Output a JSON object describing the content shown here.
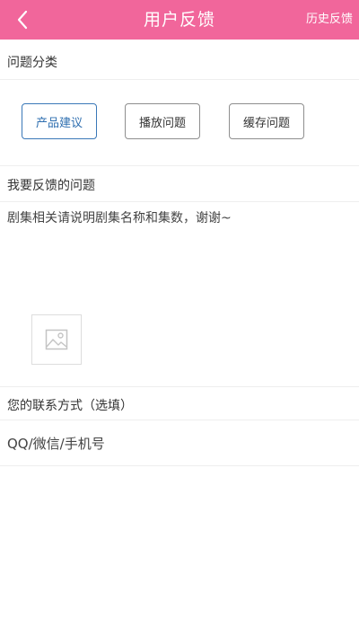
{
  "header": {
    "title": "用户反馈",
    "history_label": "历史反馈",
    "back_icon": "chevron-left-icon",
    "background_color": "#f1669b"
  },
  "category": {
    "label": "问题分类",
    "options": [
      "产品建议",
      "播放问题",
      "缓存问题"
    ],
    "selected": "产品建议",
    "selected_color": "#3a78b8"
  },
  "feedback": {
    "label": "我要反馈的问题",
    "placeholder": "剧集相关请说明剧集名称和集数，谢谢~",
    "image_picker_icon": "image-placeholder-icon"
  },
  "contact": {
    "label": "您的联系方式（选填）",
    "placeholder": "QQ/微信/手机号"
  }
}
